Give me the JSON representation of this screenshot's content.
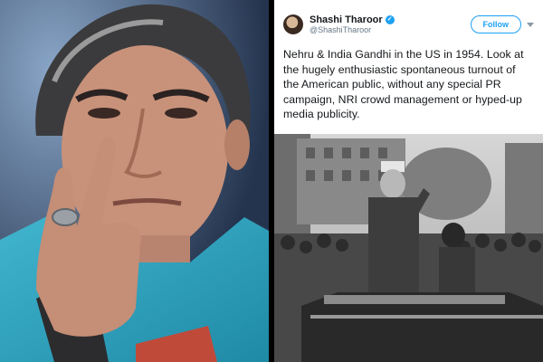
{
  "tweet": {
    "display_name": "Shashi Tharoor",
    "handle": "@ShashiTharoor",
    "follow_label": "Follow",
    "text": "Nehru & India Gandhi in the US in 1954. Look at the hugely enthusiastic spontaneous turnout of the American public, without any special PR campaign, NRI crowd management or hyped-up media publicity.",
    "accent_color": "#1da1f2"
  },
  "images": {
    "left": "portrait-photo",
    "right": "archival-motorcade-photo"
  }
}
